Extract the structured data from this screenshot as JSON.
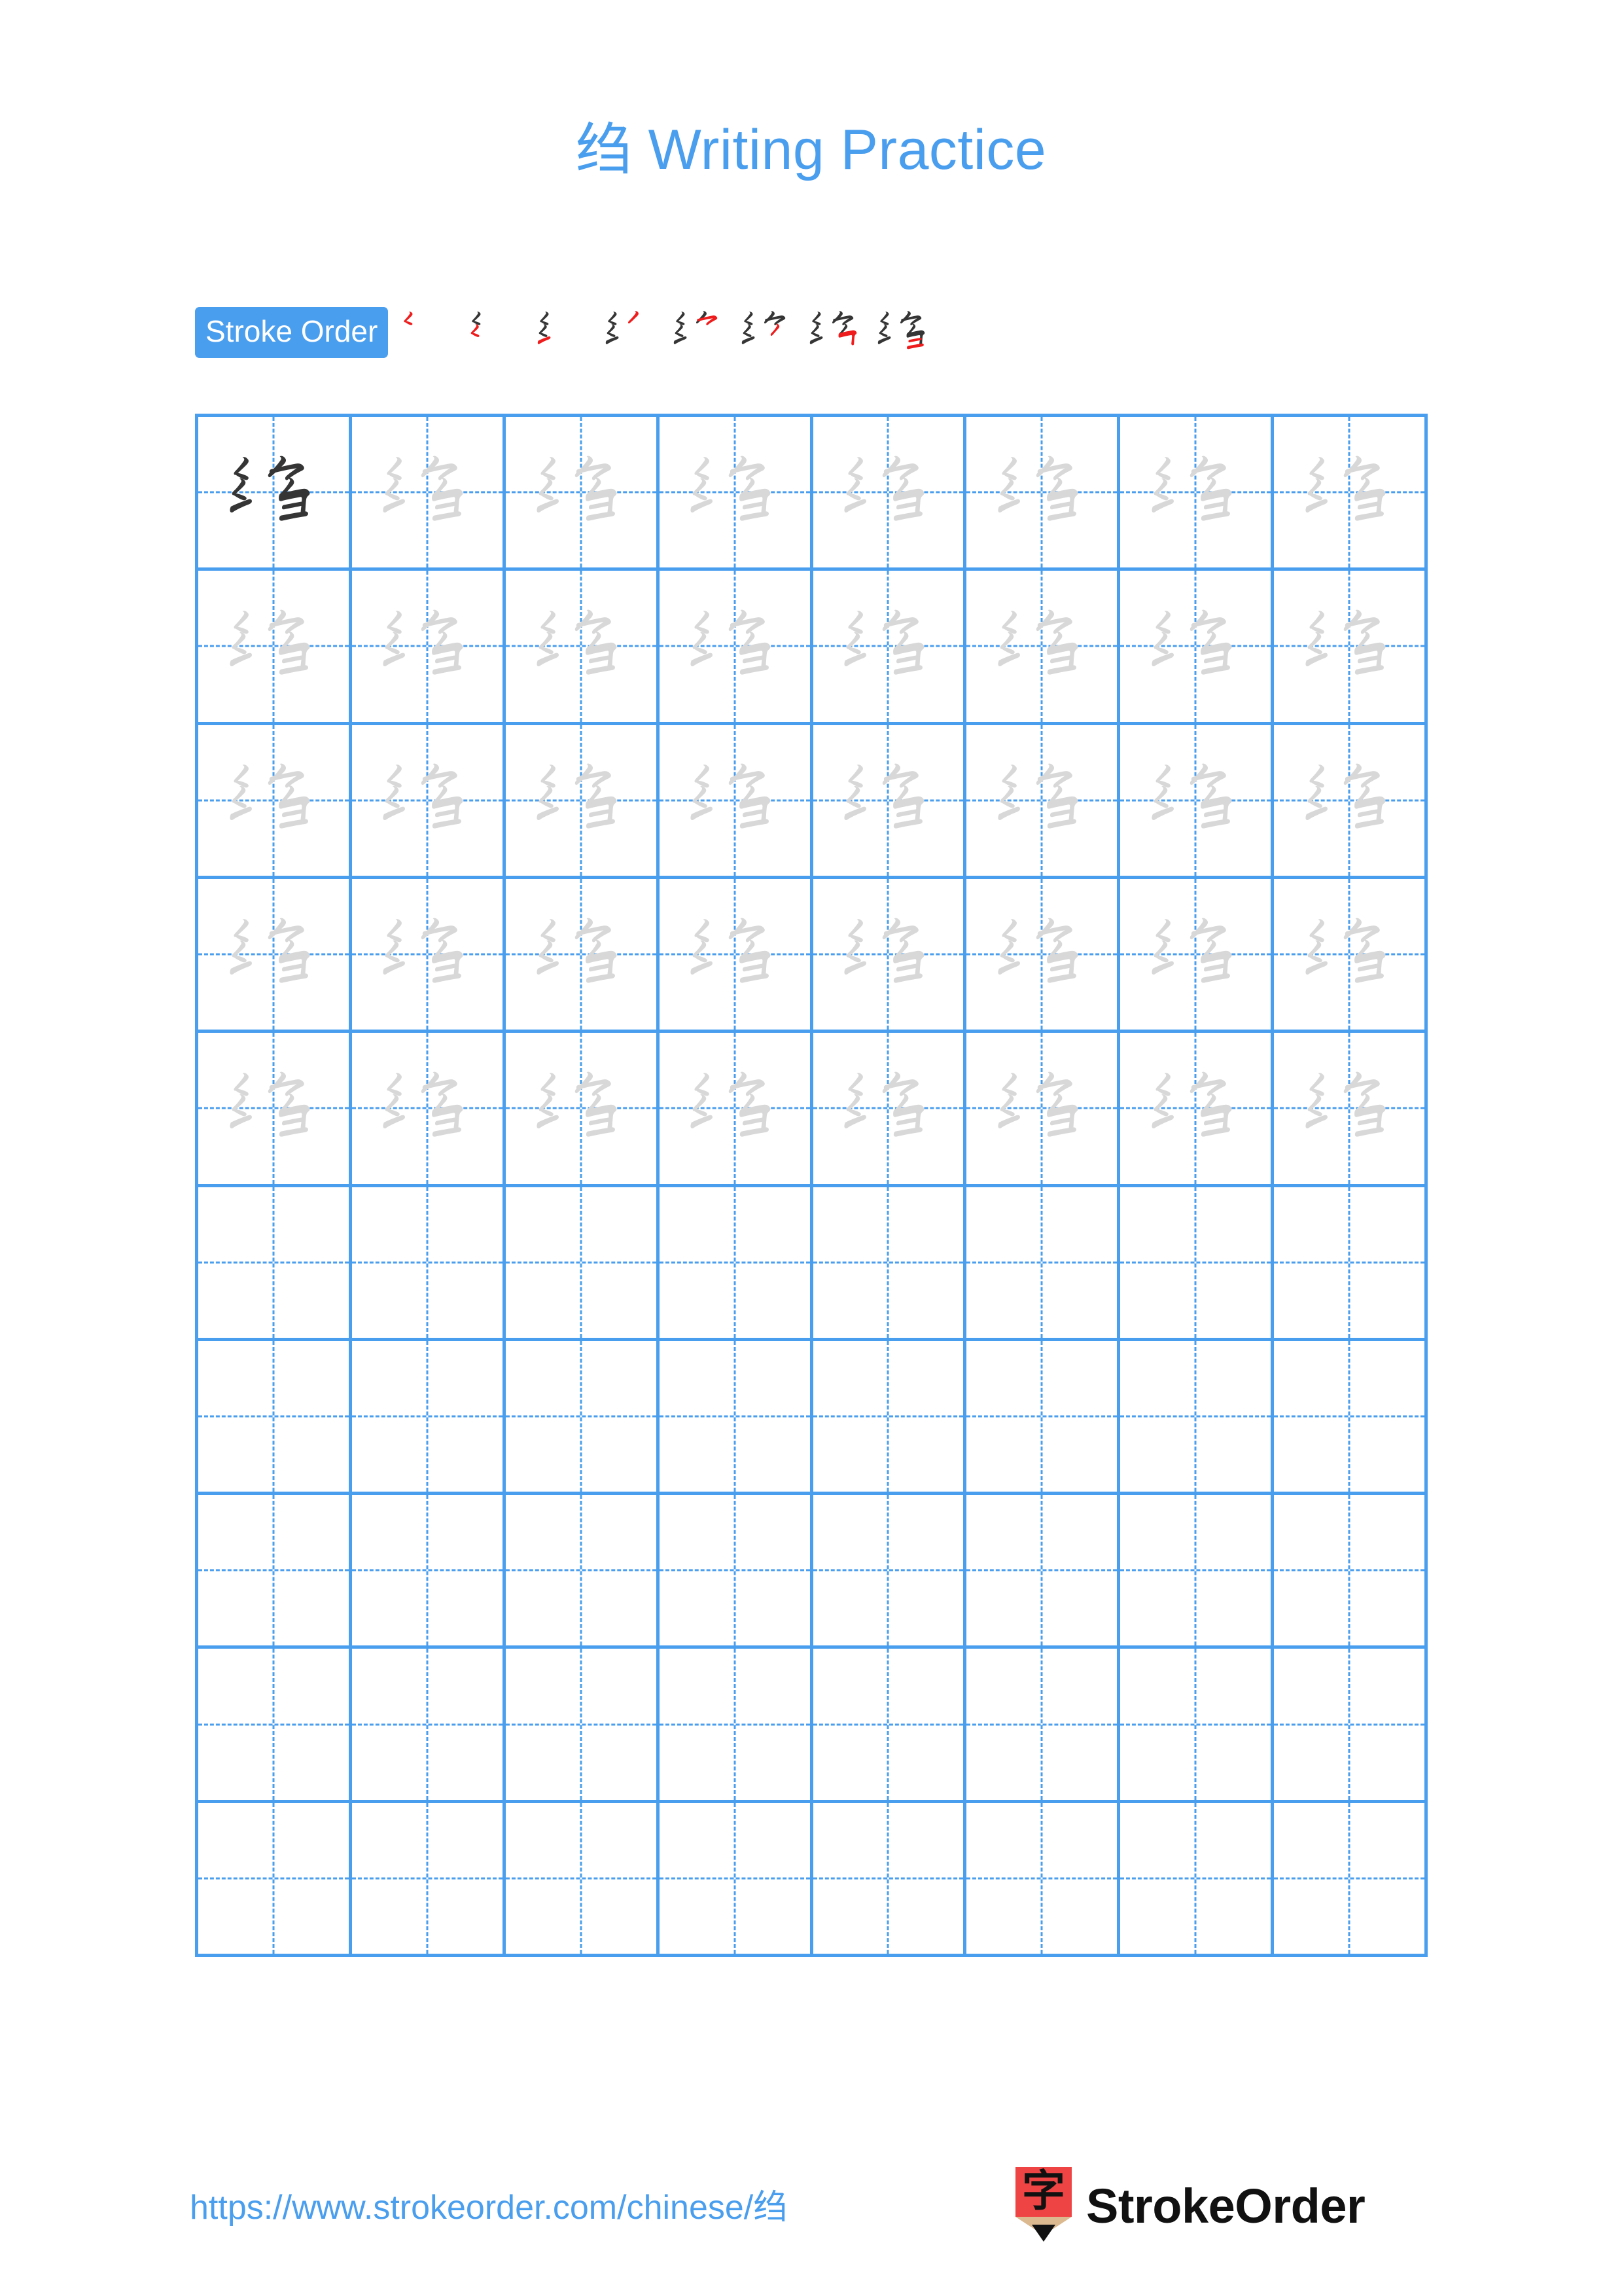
{
  "document": {
    "character": "绉",
    "title_suffix": "Writing Practice",
    "title_full": "绉 Writing Practice"
  },
  "stroke_order": {
    "badge_label": "Stroke Order",
    "stroke_count": 8,
    "steps": [
      {
        "index": 1,
        "strokes_shown": 1,
        "new_stroke_color": "#ee1c1c"
      },
      {
        "index": 2,
        "strokes_shown": 2,
        "new_stroke_color": "#ee1c1c"
      },
      {
        "index": 3,
        "strokes_shown": 3,
        "new_stroke_color": "#ee1c1c"
      },
      {
        "index": 4,
        "strokes_shown": 4,
        "new_stroke_color": "#ee1c1c"
      },
      {
        "index": 5,
        "strokes_shown": 5,
        "new_stroke_color": "#ee1c1c"
      },
      {
        "index": 6,
        "strokes_shown": 6,
        "new_stroke_color": "#ee1c1c"
      },
      {
        "index": 7,
        "strokes_shown": 7,
        "new_stroke_color": "#ee1c1c"
      },
      {
        "index": 8,
        "strokes_shown": 8,
        "new_stroke_color": "#ee1c1c"
      }
    ]
  },
  "practice_grid": {
    "columns": 8,
    "rows": 10,
    "traced_rows": 5,
    "empty_rows": 5,
    "model_cell": {
      "row": 1,
      "column": 1,
      "ink": "dark"
    },
    "cell_character": "绉"
  },
  "colors": {
    "accent_blue": "#4a9eee",
    "title_blue": "#4a9eee",
    "grid_line": "#4a9eee",
    "guide_line": "#4a9eee",
    "model_ink": "#353535",
    "trace_ink": "#d8d8d8",
    "stroke_new": "#ee1c1c",
    "stroke_done": "#353535",
    "logo_red": "#ef4444",
    "logo_wood": "#dcb98f",
    "logo_tip": "#111111",
    "background": "#ffffff"
  },
  "footer": {
    "url": "https://www.strokeorder.com/chinese/绉",
    "brand_name": "StrokeOrder",
    "logo_glyph": "字"
  }
}
